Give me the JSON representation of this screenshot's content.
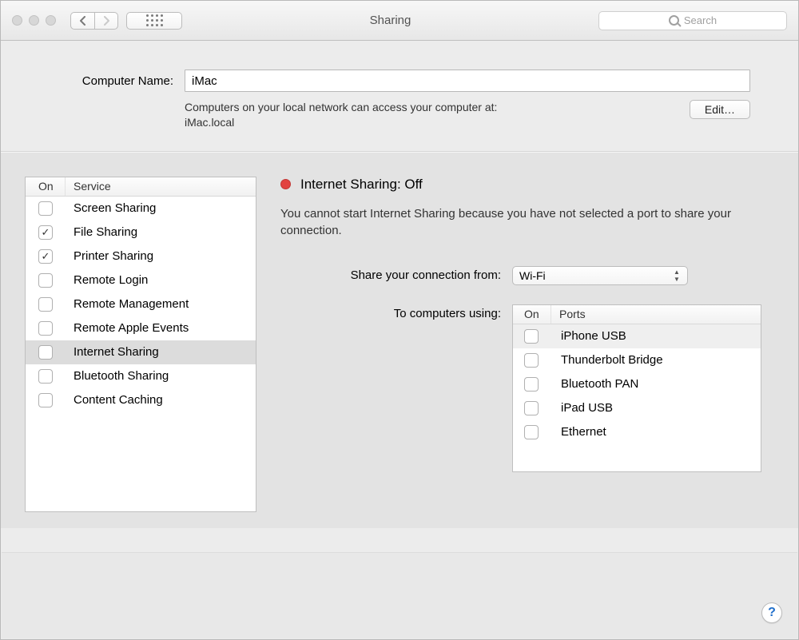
{
  "window": {
    "title": "Sharing"
  },
  "search": {
    "placeholder": "Search"
  },
  "computerName": {
    "label": "Computer Name:",
    "value": "iMac",
    "subtext1": "Computers on your local network can access your computer at:",
    "subtext2": "iMac.local",
    "editLabel": "Edit…"
  },
  "servicesTable": {
    "onHeader": "On",
    "serviceHeader": "Service"
  },
  "services": [
    {
      "on": false,
      "name": "Screen Sharing",
      "selected": false
    },
    {
      "on": true,
      "name": "File Sharing",
      "selected": false
    },
    {
      "on": true,
      "name": "Printer Sharing",
      "selected": false
    },
    {
      "on": false,
      "name": "Remote Login",
      "selected": false
    },
    {
      "on": false,
      "name": "Remote Management",
      "selected": false
    },
    {
      "on": false,
      "name": "Remote Apple Events",
      "selected": false
    },
    {
      "on": false,
      "name": "Internet Sharing",
      "selected": true
    },
    {
      "on": false,
      "name": "Bluetooth Sharing",
      "selected": false
    },
    {
      "on": false,
      "name": "Content Caching",
      "selected": false
    }
  ],
  "detail": {
    "title": "Internet Sharing: Off",
    "desc": "You cannot start Internet Sharing because you have not selected a port to share your connection.",
    "shareFromLabel": "Share your connection from:",
    "shareFromValue": "Wi-Fi",
    "toComputersLabel": "To computers using:"
  },
  "portsTable": {
    "onHeader": "On",
    "portsHeader": "Ports"
  },
  "ports": [
    {
      "on": false,
      "name": "iPhone USB"
    },
    {
      "on": false,
      "name": "Thunderbolt Bridge"
    },
    {
      "on": false,
      "name": "Bluetooth PAN"
    },
    {
      "on": false,
      "name": "iPad USB"
    },
    {
      "on": false,
      "name": "Ethernet"
    }
  ],
  "help": "?"
}
